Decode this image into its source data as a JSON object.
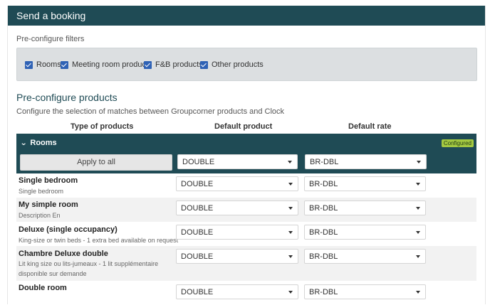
{
  "header": {
    "title": "Send a booking"
  },
  "filters": {
    "label": "Pre-configure filters",
    "items": [
      {
        "label": "Rooms",
        "checked": true
      },
      {
        "label": "Meeting room products",
        "checked": true
      },
      {
        "label": "F&B products",
        "checked": true
      },
      {
        "label": "Other products",
        "checked": true
      }
    ]
  },
  "products": {
    "title": "Pre-configure products",
    "description": "Configure the selection of matches between Groupcorner products and Clock",
    "columns": [
      "Type of products",
      "Default product",
      "Default rate"
    ]
  },
  "rooms_group": {
    "title": "Rooms",
    "badge": "Configured",
    "apply_label": "Apply to all",
    "default_product": "DOUBLE",
    "default_rate": "BR-DBL",
    "rows": [
      {
        "name": "Single bedroom",
        "description": "Single bedroom",
        "product": "DOUBLE",
        "rate": "BR-DBL"
      },
      {
        "name": "My simple room",
        "description": "Description En",
        "product": "DOUBLE",
        "rate": "BR-DBL"
      },
      {
        "name": "Deluxe (single occupancy)",
        "description": "King-size or twin beds - 1 extra bed available on request",
        "product": "DOUBLE",
        "rate": "BR-DBL"
      },
      {
        "name": "Chambre Deluxe double",
        "description": "Lit king size ou lits-jumeaux - 1 lit supplémentaire disponible sur demande",
        "product": "DOUBLE",
        "rate": "BR-DBL"
      },
      {
        "name": "Double room",
        "description": "",
        "product": "DOUBLE",
        "rate": "BR-DBL"
      }
    ]
  },
  "colors": {
    "header_bg": "#1f4b55",
    "badge_bg": "#a4c941",
    "checkbox": "#2f62b5"
  }
}
